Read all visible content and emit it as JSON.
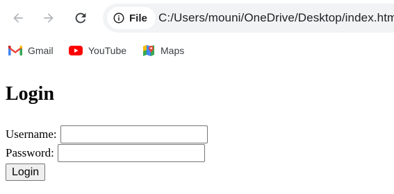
{
  "browser": {
    "site_chip_label": "File",
    "address": "C:/Users/mouni/OneDrive/Desktop/index.html",
    "icons": {
      "back": "back-arrow-icon",
      "forward": "forward-arrow-icon",
      "reload": "reload-icon",
      "site_info": "info-icon"
    }
  },
  "bookmarks": [
    {
      "label": "Gmail",
      "icon": "gmail-icon"
    },
    {
      "label": "YouTube",
      "icon": "youtube-icon"
    },
    {
      "label": "Maps",
      "icon": "maps-icon"
    }
  ],
  "page": {
    "heading": "Login",
    "username_label": "Username:",
    "username_value": "",
    "password_label": "Password:",
    "password_value": "",
    "submit_label": "Login"
  },
  "colors": {
    "omnibox_bg": "#f1f3f4",
    "youtube_red": "#ff0000",
    "gmail_red": "#ea4335",
    "toolbar_icon": "#5f6368"
  }
}
